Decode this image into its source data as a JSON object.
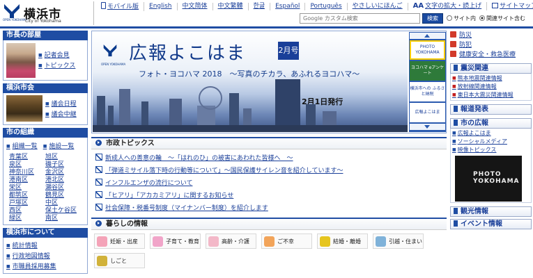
{
  "header": {
    "logo_text": "横浜市",
    "logo_sub": "City of Yokohama",
    "logo_open": "OPEN YOKOHAMA",
    "links": [
      "モバイル版",
      "English",
      "中文简体",
      "中文繁體",
      "한글",
      "Español",
      "Português",
      "やさしいにほんご"
    ],
    "font_size": "文字の拡大・読上げ",
    "sitemap": "サイトマップ",
    "search_placeholder": "Google カスタム検索",
    "search_button": "検索",
    "radio_site": "サイト内",
    "radio_related": "関連サイト含む"
  },
  "left": {
    "mayor_title": "市長の部屋",
    "mayor_links": [
      "記者会見",
      "トピックス"
    ],
    "council_title": "横浜市会",
    "council_links": [
      "議会日程",
      "議会中継"
    ],
    "org_title": "市の組織",
    "org_links": [
      "組織一覧",
      "施設一覧"
    ],
    "wards": [
      "青葉区",
      "旭区",
      "泉区",
      "磯子区",
      "神奈川区",
      "金沢区",
      "港南区",
      "港北区",
      "栄区",
      "瀬谷区",
      "都筑区",
      "鶴見区",
      "戸塚区",
      "中区",
      "西区",
      "保土ケ谷区",
      "緑区",
      "南区"
    ],
    "about_title": "横浜市について",
    "about_links": [
      "統計情報",
      "行政地図情報",
      "市職員採用募集"
    ]
  },
  "banner": {
    "logo_open": "OPEN YOKOHAMA",
    "title": "広報よこはま",
    "month": "2月号",
    "subtitle": "フォト・ヨコハマ 2018　～写真のチカラ、あふれるヨコハマ～",
    "date": "2月1日発行",
    "side_items": [
      "PHOTO YOKOHAMA",
      "ヨコハマ eアンケート",
      "横浜市への ふるさと納税",
      "広報よこはま"
    ]
  },
  "topics": {
    "title": "市政トピックス",
    "items": [
      "新成人への善意の輪　～「はれのひ」の被害にあわれた皆様へ　～",
      "「弾道ミサイル落下時の行動等について」～国民保護サイレン音を紹介しています～",
      "インフルエンザの流行について",
      "「ヒアリ」「アカカミアリ」に関するお知らせ",
      "社会保障・税番号制度（マイナンバー制度）を紹介します"
    ]
  },
  "life": {
    "title": "暮らしの情報",
    "categories": [
      {
        "label": "妊娠・出産",
        "color": "#f4a3b8"
      },
      {
        "label": "子育て・教育",
        "color": "#f1a5c9"
      },
      {
        "label": "高齢・介護",
        "color": "#f3b8c8"
      },
      {
        "label": "ご不幸",
        "color": "#f2a45a"
      },
      {
        "label": "結婚・離婚",
        "color": "#e6c51f"
      },
      {
        "label": "引越・住まい",
        "color": "#7fb2d9"
      },
      {
        "label": "しごと",
        "color": "#d1b23a"
      }
    ]
  },
  "right": {
    "quick": [
      "防災",
      "防犯",
      "健康安全・救急医療"
    ],
    "disaster_title": "震災関連",
    "disaster_links": [
      "熊本地震関連情報",
      "放射線関連情報",
      "東日本大震災関連情報"
    ],
    "press_title": "報道発表",
    "pr_title": "市の広報",
    "pr_links": [
      "広報よこはま",
      "ソーシャルメディア",
      "映像トピックス"
    ],
    "photo_label": "PHOTO YOKOHAMA",
    "tourism_title": "観光情報",
    "event_title": "イベント情報"
  }
}
